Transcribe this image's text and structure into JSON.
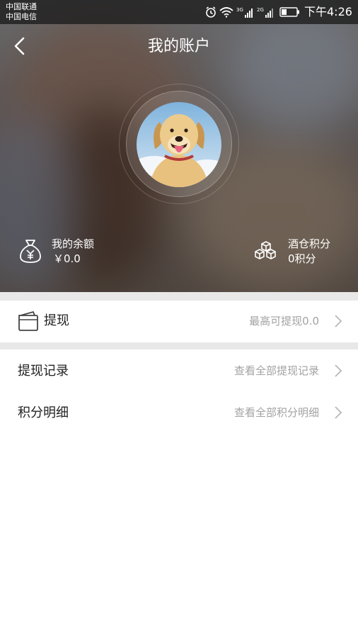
{
  "status_bar": {
    "carrier_1": "中国联通",
    "carrier_2": "中国电信",
    "net_3g": "3G",
    "net_2g": "2G",
    "time": "下午4:26"
  },
  "header": {
    "title": "我的账户"
  },
  "balance": {
    "label": "我的余额",
    "value": "￥0.0",
    "icon": "money-bag-icon"
  },
  "points": {
    "label": "酒仓积分",
    "value": "0积分",
    "icon": "boxes-icon"
  },
  "withdraw": {
    "label": "提现",
    "hint": "最高可提现0.0",
    "icon": "wallet-icon"
  },
  "records": {
    "label": "提现记录",
    "hint": "查看全部提现记录"
  },
  "points_detail": {
    "label": "积分明细",
    "hint": "查看全部积分明细"
  },
  "colors": {
    "divider": "#e8e8e8",
    "hint_text": "#a2a2a2",
    "primary_text": "#222222"
  }
}
